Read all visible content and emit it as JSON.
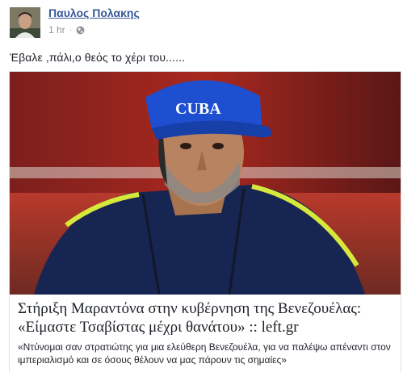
{
  "post": {
    "author": "Παυλος Πολακης",
    "time": "1 hr",
    "separator": "·",
    "privacy_icon": "globe-icon",
    "text": "Έβαλε ,πάλι,ο θεός το χέρι του......"
  },
  "link_card": {
    "image_caption_on_cap": "CUBA",
    "title": "Στήριξη Μαραντόνα στην κυβέρνηση της Βενεζουέλας: «Είμαστε Τσαβίστας μέχρι θανάτου» :: left.gr",
    "description": "«Ντύνομαι σαν στρατιώτης για μια ελεύθερη Βενεζουέλα, για να παλέψω απέναντι στον ιμπεριαλισμό και σε όσους θέλουν να μας πάρουν τις σημαίες»"
  },
  "colors": {
    "author_link": "#365899",
    "meta_gray": "#90949c",
    "text": "#1d2129",
    "card_border": "#dddfe2",
    "cap_blue": "#1f4fd1"
  }
}
